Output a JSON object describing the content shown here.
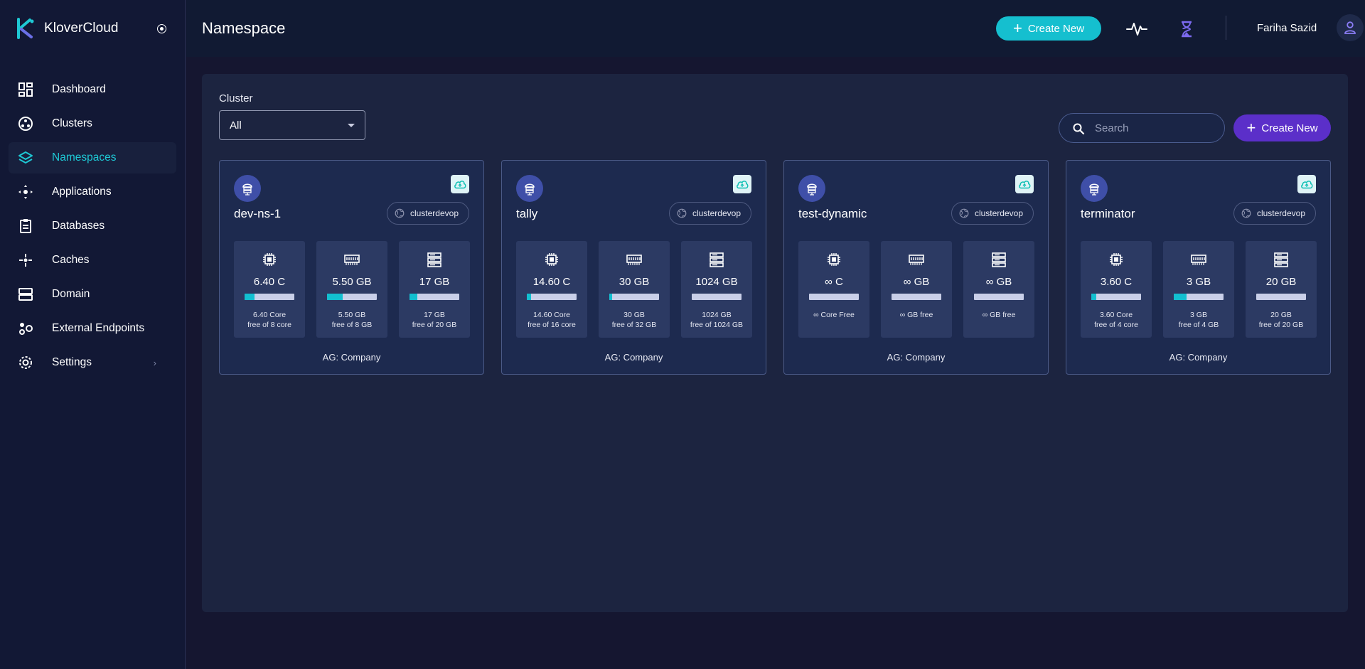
{
  "app": {
    "name": "KloverCloud"
  },
  "sidebar": {
    "items": [
      {
        "label": "Dashboard",
        "icon": "dashboard-icon"
      },
      {
        "label": "Clusters",
        "icon": "clusters-icon"
      },
      {
        "label": "Namespaces",
        "icon": "namespaces-icon",
        "active": true
      },
      {
        "label": "Applications",
        "icon": "applications-icon"
      },
      {
        "label": "Databases",
        "icon": "databases-icon"
      },
      {
        "label": "Caches",
        "icon": "caches-icon"
      },
      {
        "label": "Domain",
        "icon": "domain-icon"
      },
      {
        "label": "External Endpoints",
        "icon": "external-endpoints-icon"
      },
      {
        "label": "Settings",
        "icon": "settings-icon",
        "chevron": "›"
      }
    ]
  },
  "header": {
    "title": "Namespace",
    "create_label": "Create New",
    "user_name": "Fariha Sazid"
  },
  "filters": {
    "cluster_label": "Cluster",
    "cluster_value": "All",
    "search_placeholder": "Search",
    "create_label": "Create New"
  },
  "colors": {
    "accent_cyan": "#15bfcf",
    "accent_purple": "#5b2fc9",
    "active_nav": "#1ec8d4"
  },
  "namespaces": [
    {
      "name": "dev-ns-1",
      "cluster": "clusterdevop",
      "group": "AG: Company",
      "metrics": [
        {
          "icon": "cpu-icon",
          "value": "6.40 C",
          "line1": "6.40 Core",
          "line2": "free of 8 core",
          "used_fraction": 0.2
        },
        {
          "icon": "memory-icon",
          "value": "5.50 GB",
          "line1": "5.50 GB",
          "line2": "free of 8 GB",
          "used_fraction": 0.31
        },
        {
          "icon": "storage-icon",
          "value": "17 GB",
          "line1": "17 GB",
          "line2": "free of 20 GB",
          "used_fraction": 0.15
        }
      ]
    },
    {
      "name": "tally",
      "cluster": "clusterdevop",
      "group": "AG: Company",
      "metrics": [
        {
          "icon": "cpu-icon",
          "value": "14.60 C",
          "line1": "14.60 Core",
          "line2": "free of 16 core",
          "used_fraction": 0.09
        },
        {
          "icon": "memory-icon",
          "value": "30 GB",
          "line1": "30 GB",
          "line2": "free of 32 GB",
          "used_fraction": 0.06
        },
        {
          "icon": "storage-icon",
          "value": "1024 GB",
          "line1": "1024 GB",
          "line2": "free of 1024 GB",
          "used_fraction": 0
        }
      ]
    },
    {
      "name": "test-dynamic",
      "cluster": "clusterdevop",
      "group": "AG: Company",
      "metrics": [
        {
          "icon": "cpu-icon",
          "value": "∞ C",
          "line1": "∞ Core Free",
          "line2": "",
          "used_fraction": 0
        },
        {
          "icon": "memory-icon",
          "value": "∞ GB",
          "line1": "∞ GB free",
          "line2": "",
          "used_fraction": 0
        },
        {
          "icon": "storage-icon",
          "value": "∞ GB",
          "line1": "∞ GB free",
          "line2": "",
          "used_fraction": 0
        }
      ]
    },
    {
      "name": "terminator",
      "cluster": "clusterdevop",
      "group": "AG: Company",
      "metrics": [
        {
          "icon": "cpu-icon",
          "value": "3.60 C",
          "line1": "3.60 Core",
          "line2": "free of 4 core",
          "used_fraction": 0.1
        },
        {
          "icon": "memory-icon",
          "value": "3 GB",
          "line1": "3 GB",
          "line2": "free of 4 GB",
          "used_fraction": 0.25
        },
        {
          "icon": "storage-icon",
          "value": "20 GB",
          "line1": "20 GB",
          "line2": "free of 20 GB",
          "used_fraction": 0
        }
      ]
    }
  ]
}
